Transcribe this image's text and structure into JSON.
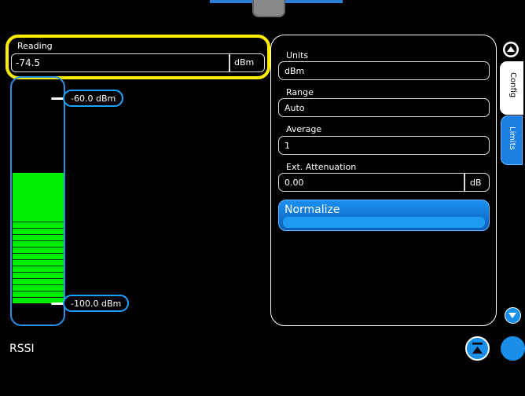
{
  "reading": {
    "label": "Reading",
    "value": "-74.5",
    "unit": "dBm"
  },
  "meter": {
    "upper_marker": "-60.0 dBm",
    "lower_marker": "-100.0 dBm",
    "fill_level_fraction": 0.53
  },
  "config": {
    "units": {
      "label": "Units",
      "value": "dBm"
    },
    "range": {
      "label": "Range",
      "value": "Auto"
    },
    "average": {
      "label": "Average",
      "value": "1"
    },
    "ext_attenuation": {
      "label": "Ext. Attenuation",
      "value": "0.00",
      "unit": "dB"
    },
    "normalize_label": "Normalize"
  },
  "tabs": {
    "config": "Config",
    "limits": "Limits"
  },
  "footer": {
    "title": "RSSI"
  },
  "colors": {
    "accent": "#1a8fea",
    "highlight": "#ffee00",
    "meter_fill": "#00ee00"
  },
  "icons": {
    "scroll_up": "chevron-up-icon",
    "scroll_down": "chevron-down-icon",
    "home": "home-icon"
  }
}
